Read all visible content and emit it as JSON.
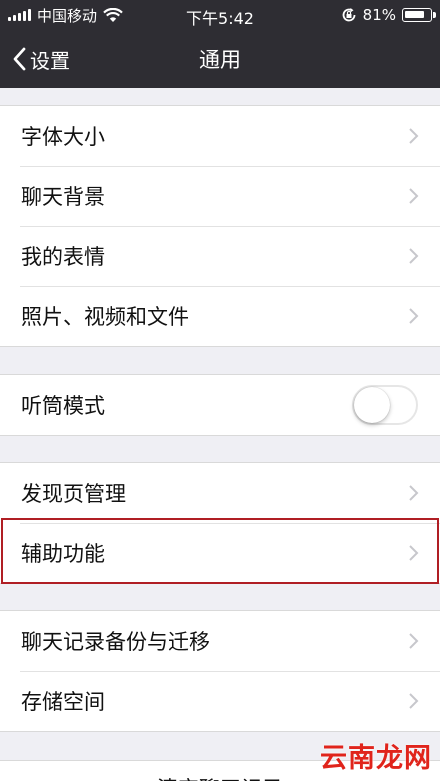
{
  "status_bar": {
    "carrier": "中国移动",
    "time": "下午5:42",
    "battery_percent": "81%",
    "battery_level": 0.81
  },
  "nav": {
    "back_label": "设置",
    "title": "通用"
  },
  "groups": {
    "display": [
      "字体大小",
      "聊天背景",
      "我的表情",
      "照片、视频和文件"
    ],
    "earpiece": {
      "label": "听筒模式",
      "on": false
    },
    "discover": [
      "发现页管理",
      "辅助功能"
    ],
    "storage": [
      "聊天记录备份与迁移",
      "存储空间"
    ]
  },
  "bottom_button_partial": "清空聊天记录",
  "watermark": "云南龙网",
  "colors": {
    "bar_bg": "#2e2d33",
    "page_bg": "#efeff4",
    "highlight_border": "#b01e24",
    "watermark": "#e0241b"
  }
}
